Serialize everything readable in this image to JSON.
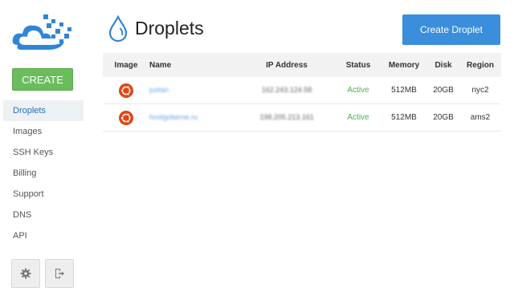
{
  "header": {
    "title": "Droplets",
    "create_droplet_label": "Create Droplet"
  },
  "sidebar": {
    "create_label": "CREATE",
    "items": [
      {
        "label": "Droplets",
        "active": true
      },
      {
        "label": "Images",
        "active": false
      },
      {
        "label": "SSH Keys",
        "active": false
      },
      {
        "label": "Billing",
        "active": false
      },
      {
        "label": "Support",
        "active": false
      },
      {
        "label": "DNS",
        "active": false
      },
      {
        "label": "API",
        "active": false
      }
    ],
    "footer": [
      "gear-icon",
      "logout-icon"
    ]
  },
  "table": {
    "columns": [
      "Image",
      "Name",
      "IP Address",
      "Status",
      "Memory",
      "Disk",
      "Region"
    ],
    "rows": [
      {
        "image": "ubuntu-icon",
        "name": "justan",
        "ip": "162.243.124.58",
        "status": "Active",
        "memory": "512MB",
        "disk": "20GB",
        "region": "nyc2"
      },
      {
        "image": "ubuntu-icon",
        "name": "hostgobeme.ru",
        "ip": "198.205.213.161",
        "status": "Active",
        "memory": "512MB",
        "disk": "20GB",
        "region": "ams2"
      }
    ]
  },
  "colors": {
    "create_green": "#69bd5a",
    "primary_blue": "#3a8edc",
    "active_green": "#4caf50",
    "ubuntu_orange": "#dd4814"
  }
}
